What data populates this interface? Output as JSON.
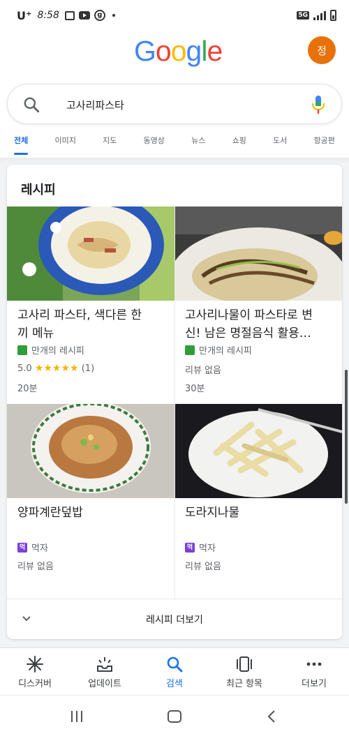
{
  "status_bar": {
    "carrier": "U⁺",
    "time": "8:58",
    "network": "5G"
  },
  "header": {
    "logo_letters": [
      "G",
      "o",
      "o",
      "g",
      "l",
      "e"
    ],
    "logo_colors": [
      "#4285f4",
      "#ea4335",
      "#fbbc05",
      "#4285f4",
      "#34a853",
      "#ea4335"
    ],
    "avatar_initial": "정",
    "avatar_color": "#e8710a"
  },
  "search": {
    "query": "고사리파스타"
  },
  "tabs": [
    {
      "label": "전체",
      "active": true
    },
    {
      "label": "이미지",
      "active": false
    },
    {
      "label": "지도",
      "active": false
    },
    {
      "label": "동영상",
      "active": false
    },
    {
      "label": "뉴스",
      "active": false
    },
    {
      "label": "쇼핑",
      "active": false
    },
    {
      "label": "도서",
      "active": false
    },
    {
      "label": "항공편",
      "active": false
    }
  ],
  "recipes_card": {
    "title": "레시피",
    "items": [
      {
        "title_line1": "고사리 파스타, 색다른 한",
        "title_line2": "끼 메뉴",
        "source": "만개의 레시피",
        "rating": "5.0",
        "stars": "★★★★★",
        "reviews": "(1)",
        "time": "20분"
      },
      {
        "title_line1": "고사리나물이 파스타로 변",
        "title_line2": "신! 남은 명절음식 활용…",
        "source": "만개의 레시피",
        "reviews_text": "리뷰 없음",
        "time": "30분"
      },
      {
        "title_line1": "양파계란덮밥",
        "source": "먹자",
        "source_badge": "먹",
        "reviews_text": "리뷰 없음"
      },
      {
        "title_line1": "도라지나물",
        "source": "먹자",
        "source_badge": "먹",
        "reviews_text": "리뷰 없음"
      }
    ],
    "more_label": "레시피 더보기"
  },
  "bottom_nav": [
    {
      "label": "디스커버",
      "icon": "asterisk-icon"
    },
    {
      "label": "업데이트",
      "icon": "updates-icon"
    },
    {
      "label": "검색",
      "icon": "search-icon",
      "active": true
    },
    {
      "label": "최근 항목",
      "icon": "recent-tabs-icon"
    },
    {
      "label": "더보기",
      "icon": "more-dots-icon"
    }
  ],
  "colors": {
    "accent": "#1a73e8",
    "star": "#f4b400",
    "source_green": "#2e9e3b",
    "source_purple": "#7b3fd6"
  }
}
